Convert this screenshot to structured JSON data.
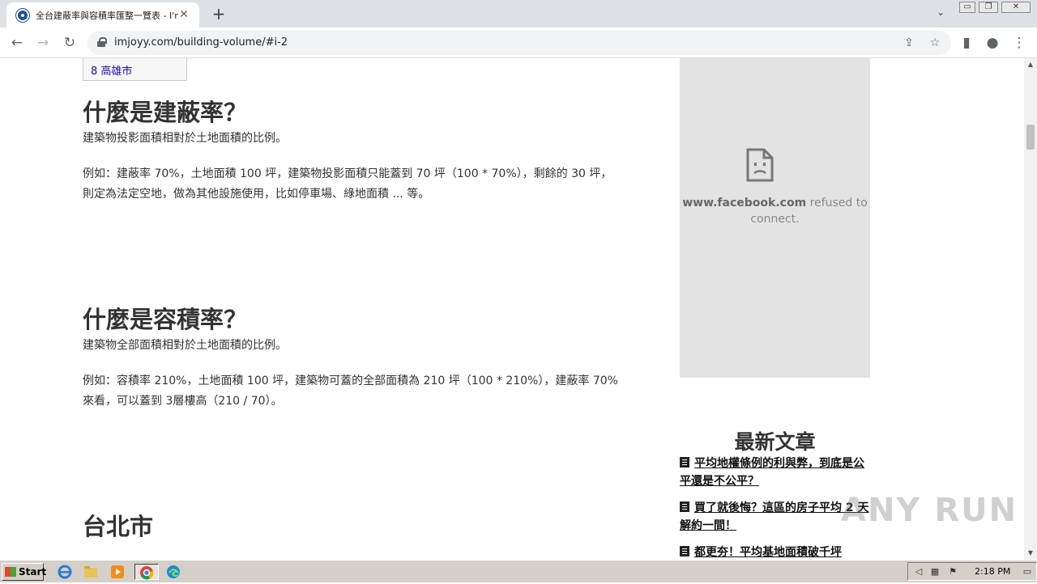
{
  "browser": {
    "tab_title": "全台建蔽率與容積率匯整一覽表 - I'm",
    "tab_close": "✕",
    "new_tab": "+",
    "url": "imjoyy.com/building-volume/#i-2"
  },
  "toc": {
    "item": "8 高雄市"
  },
  "sections": {
    "coverage_title": "什麼是建蔽率？",
    "coverage_def": "建築物投影面積相對於土地面積的比例。",
    "coverage_example_1": "例如：建蔽率 70%，土地面積 100 坪，建築物投影面積只能蓋到 70 坪（100 * 70%），剩餘的 30 坪，",
    "coverage_example_2": "則定為法定空地，做為其他設施使用，比如停車場、綠地面積 ... 等。",
    "far_title": "什麼是容積率？",
    "far_def": "建築物全部面積相對於土地面積的比例。",
    "far_example_1": "例如：容積率 210%，土地面積 100 坪，建築物可蓋的全部面積為 210 坪（100 * 210%），建蔽率 70%",
    "far_example_2": "來看，可以蓋到 3層樓高（210 / 70）。",
    "taipei_title": "台北市"
  },
  "facebook_embed": {
    "domain": "www.facebook.com",
    "message": "refused to connect."
  },
  "sidebar": {
    "title": "最新文章",
    "articles": [
      "平均地權條例的利與弊，到底是公平還是不公平？",
      "買了就後悔？這區的房子平均 2 天解約一間！",
      "都更夯！平均基地面積破千坪"
    ]
  },
  "watermark": "ANY RUN",
  "taskbar": {
    "start_label": "Start",
    "clock": "2:18 PM"
  }
}
